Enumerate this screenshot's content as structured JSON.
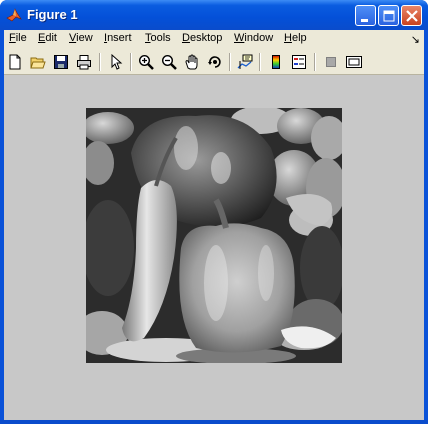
{
  "window": {
    "title": "Figure 1",
    "controls": {
      "minimize": "minimize-icon",
      "maximize": "maximize-icon",
      "close": "close-icon"
    }
  },
  "menubar": {
    "items": [
      "File",
      "Edit",
      "View",
      "Insert",
      "Tools",
      "Desktop",
      "Window",
      "Help"
    ],
    "dock_icon": "↘"
  },
  "toolbar": {
    "buttons": [
      "new-figure-icon",
      "open-file-icon",
      "save-icon",
      "print-icon",
      "edit-plot-arrow-icon",
      "zoom-in-icon",
      "zoom-out-icon",
      "pan-hand-icon",
      "rotate-3d-icon",
      "data-cursor-icon",
      "insert-colorbar-icon",
      "insert-legend-icon",
      "hide-plot-tools-icon",
      "show-plot-tools-icon"
    ]
  },
  "figure": {
    "background": "#c8c8c8",
    "image": "grayscale photograph of bell peppers and chili peppers"
  },
  "colors": {
    "titlebar": "#0a52d8",
    "chrome": "#ece9d8"
  }
}
